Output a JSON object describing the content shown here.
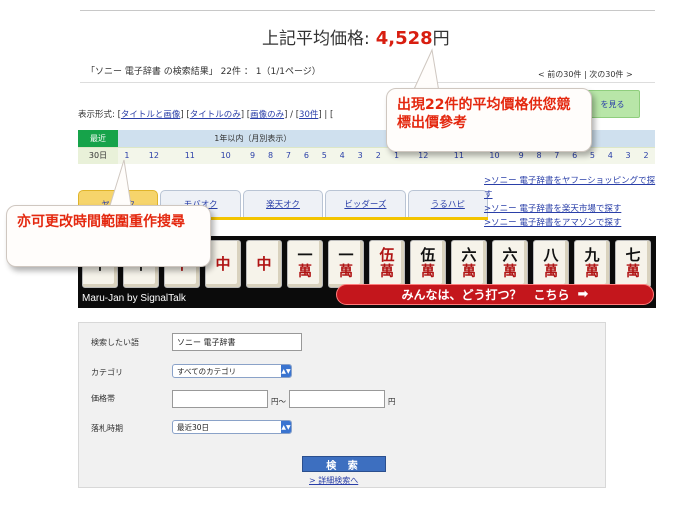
{
  "summary": {
    "label": "上記平均価格:",
    "price": "4,528",
    "unit": "円",
    "result_text": "「ソニー 電子辞書 の検索結果」 22件 ： 1（1/1ページ）",
    "prev": "< 前の30件",
    "sep": "|",
    "next": "次の30件 >"
  },
  "display_mode": {
    "prefix": "表示形式: [",
    "opt_title_image": "タイトルと画像",
    "sep1": "] [",
    "opt_title_only": "タイトルのみ",
    "opt_image_only": "画像のみ",
    "sep2": "] / [",
    "count": "30件",
    "tail": "] | ["
  },
  "green_button": "を見る",
  "period": {
    "recent_header": "最近",
    "year_header": "1年以内（月別表示）",
    "current": "30日",
    "months": [
      "1",
      "12",
      "11",
      "10",
      "9",
      "8",
      "7",
      "6",
      "5",
      "4",
      "3",
      "2",
      "1",
      "12",
      "11",
      "10",
      "9",
      "8",
      "7",
      "6",
      "5",
      "4",
      "3",
      "2"
    ]
  },
  "tabs": [
    {
      "label": "ヤフオク"
    },
    {
      "label": "モバオク"
    },
    {
      "label": "楽天オク"
    },
    {
      "label": "ビッダーズ"
    },
    {
      "label": "うるハピ"
    }
  ],
  "side_links": [
    ">ソニー 電子辞書をヤフーショッピングで探す",
    ">ソニー 電子辞書を楽天市場で探す",
    ">ソニー 電子辞書をアマゾンで探す"
  ],
  "banner": {
    "caption": "Maru-Jan by SignalTalk",
    "cta": "みんなは、どう打つ？　こちら",
    "cta_icon": "arrow-right-icon",
    "tiles": [
      {
        "t1": "不",
        "t2": "",
        "red": false
      },
      {
        "t1": "不",
        "t2": "",
        "red": false
      },
      {
        "t1": "中",
        "t2": "",
        "red": true
      },
      {
        "t1": "中",
        "t2": "",
        "red": true
      },
      {
        "t1": "中",
        "t2": "",
        "red": true
      },
      {
        "t1": "一",
        "t2": "萬",
        "red": false
      },
      {
        "t1": "一",
        "t2": "萬",
        "red": false
      },
      {
        "t1": "伍",
        "t2": "萬",
        "red": true
      },
      {
        "t1": "伍",
        "t2": "萬",
        "red": false
      },
      {
        "t1": "六",
        "t2": "萬",
        "red": false
      },
      {
        "t1": "六",
        "t2": "萬",
        "red": false
      },
      {
        "t1": "八",
        "t2": "萬",
        "red": false
      },
      {
        "t1": "九",
        "t2": "萬",
        "red": false
      },
      {
        "t1": "七",
        "t2": "萬",
        "red": false
      }
    ]
  },
  "search": {
    "keyword_label": "検索したい語",
    "keyword_value": "ソニー 電子辞書",
    "category_label": "カテゴリ",
    "category_value": "すべてのカテゴリ",
    "price_label": "価格帯",
    "price_from": "",
    "price_sep": "円〜",
    "price_to": "",
    "price_unit": "円",
    "period_label": "落札時期",
    "period_value": "最近30日",
    "search_button": "検 索",
    "detail_link": "> 詳細検索へ"
  },
  "callouts": {
    "top": "出現22件的平均價格供您競標出價參考",
    "left": "亦可更改時間範圍重作搜尋"
  },
  "colors": {
    "price": "#d81e10",
    "link": "#2a3fa8",
    "callout_text": "#e4280f",
    "recent_header": "#16a34a",
    "tab_active": "#f6d46b"
  }
}
